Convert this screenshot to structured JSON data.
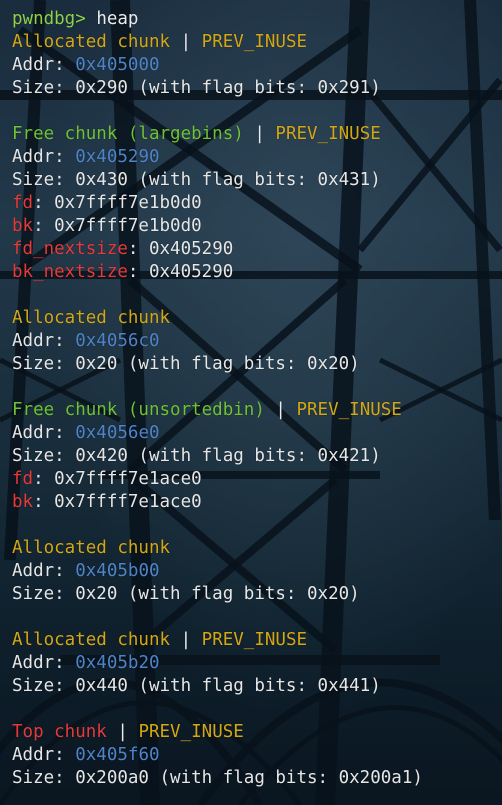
{
  "prompt": {
    "name": "pwndbg>",
    "command": "heap"
  },
  "chunks": [
    {
      "title": "Allocated chunk",
      "sep": " | ",
      "flag": "PREV_INUSE",
      "addr_label": "Addr:",
      "addr": "0x405000",
      "size_line": "Size: 0x290 (with flag bits: 0x291)"
    },
    {
      "title": "Free chunk (largebins)",
      "sep": " | ",
      "flag": "PREV_INUSE",
      "addr_label": "Addr:",
      "addr": "0x405290",
      "size_line": "Size: 0x430 (with flag bits: 0x431)",
      "ptrs": [
        {
          "key": "fd",
          "val": ": 0x7ffff7e1b0d0"
        },
        {
          "key": "bk",
          "val": ": 0x7ffff7e1b0d0"
        },
        {
          "key": "fd_nextsize",
          "val": ": 0x405290"
        },
        {
          "key": "bk_nextsize",
          "val": ": 0x405290"
        }
      ]
    },
    {
      "title": "Allocated chunk",
      "addr_label": "Addr:",
      "addr": "0x4056c0",
      "size_line": "Size: 0x20 (with flag bits: 0x20)"
    },
    {
      "title": "Free chunk (unsortedbin)",
      "sep": " | ",
      "flag": "PREV_INUSE",
      "addr_label": "Addr:",
      "addr": "0x4056e0",
      "size_line": "Size: 0x420 (with flag bits: 0x421)",
      "ptrs": [
        {
          "key": "fd",
          "val": ": 0x7ffff7e1ace0"
        },
        {
          "key": "bk",
          "val": ": 0x7ffff7e1ace0"
        }
      ]
    },
    {
      "title": "Allocated chunk",
      "addr_label": "Addr:",
      "addr": "0x405b00",
      "size_line": "Size: 0x20 (with flag bits: 0x20)"
    },
    {
      "title": "Allocated chunk",
      "sep": " | ",
      "flag": "PREV_INUSE",
      "addr_label": "Addr:",
      "addr": "0x405b20",
      "size_line": "Size: 0x440 (with flag bits: 0x441)"
    },
    {
      "title": "Top chunk",
      "sep": " | ",
      "flag": "PREV_INUSE",
      "addr_label": "Addr:",
      "addr": "0x405f60",
      "size_line": "Size: 0x200a0 (with flag bits: 0x200a1)"
    }
  ],
  "colors": {
    "prompt": "#8fd14a",
    "allocated_title": "#d4a715",
    "free_title": "#6fc135",
    "top_title": "#e63a3a",
    "flag": "#d4a715",
    "address": "#4f84c8",
    "pointer_key": "#e63a3a",
    "text": "#e6e6e6"
  }
}
